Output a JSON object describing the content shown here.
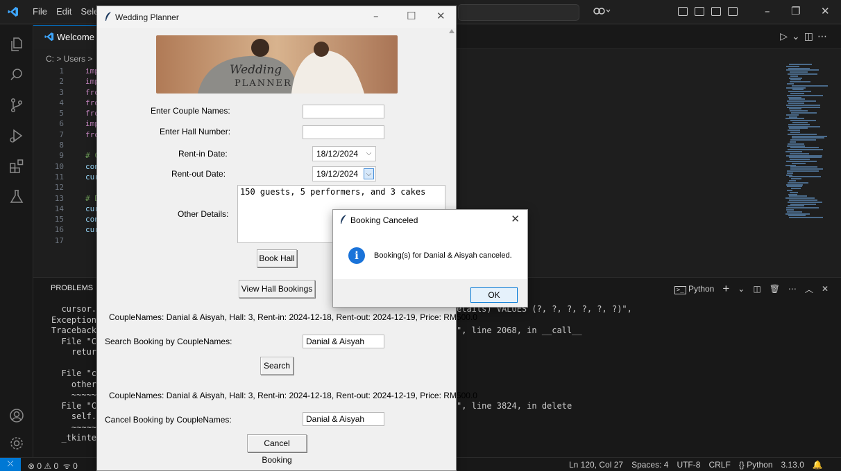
{
  "vscode": {
    "menu": [
      "File",
      "Edit",
      "Sele"
    ],
    "tab_label": "Welcome",
    "breadcrumb": "C: > Users >",
    "code_lines": [
      {
        "n": "1",
        "text": "imp",
        "cls": "kw"
      },
      {
        "n": "2",
        "text": "imp",
        "cls": "kw"
      },
      {
        "n": "3",
        "text": "fro",
        "cls": "kw"
      },
      {
        "n": "4",
        "text": "fro",
        "cls": "kw"
      },
      {
        "n": "5",
        "text": "fro",
        "cls": "kw"
      },
      {
        "n": "6",
        "text": "imp",
        "cls": "kw"
      },
      {
        "n": "7",
        "text": "fro",
        "cls": "kw"
      },
      {
        "n": "8",
        "text": "",
        "cls": ""
      },
      {
        "n": "9",
        "text": "# C",
        "cls": "cm"
      },
      {
        "n": "10",
        "text": "con",
        "cls": "var"
      },
      {
        "n": "11",
        "text": "cur",
        "cls": "var"
      },
      {
        "n": "12",
        "text": "",
        "cls": ""
      },
      {
        "n": "13",
        "text": "# D",
        "cls": "cm"
      },
      {
        "n": "14",
        "text": "cur",
        "cls": "var"
      },
      {
        "n": "15",
        "text": "con",
        "cls": "var"
      },
      {
        "n": "16",
        "text": "cur",
        "cls": "var"
      },
      {
        "n": "17",
        "text": "",
        "cls": ""
      }
    ],
    "panel_tab": "PROBLEMS",
    "terminal_profile": "Python",
    "terminal_left": [
      "  cursor.",
      "Exception",
      "Traceback",
      "  File \"C:",
      "    return",
      "",
      "  File \"c",
      "    other",
      "    ~~~~~~",
      "  File \"C:",
      "    self.t",
      "    ~~~~~~",
      "  _tkinter.T"
    ],
    "terminal_right": [
      {
        "text": "etails) VALUES (?, ?, ?, ?, ?, ?)\",",
        "row": 0
      },
      {
        "text": "\", line 2068, in __call__",
        "row": 2
      },
      {
        "text": "\", line 3824, in delete",
        "row": 9
      }
    ],
    "status": {
      "remote": "⤫",
      "problems": "⊗ 0 ⚠ 0",
      "ports": "ᯤ 0",
      "right": [
        "Ln 120, Col 27",
        "Spaces: 4",
        "UTF-8",
        "CRLF",
        "{} Python",
        "3.13.0",
        "🔔"
      ]
    }
  },
  "tk": {
    "title": "Wedding Planner",
    "banner_text_1": "Wedding",
    "banner_text_2": "PLANNER",
    "labels": {
      "couple": "Enter Couple Names:",
      "hall": "Enter Hall Number:",
      "rent_in": "Rent-in Date:",
      "rent_out": "Rent-out Date:",
      "details": "Other Details:"
    },
    "couple_value": "",
    "hall_value": "",
    "rent_in_value": "18/12/2024",
    "rent_out_value": "19/12/2024",
    "details_value": "150 guests, 5 performers, and 3 cakes",
    "book_button": "Book Hall",
    "view_button": "View Hall Bookings",
    "booking_result_1": "CoupleNames: Danial & Aisyah, Hall: 3, Rent-in: 2024-12-18, Rent-out: 2024-12-19, Price: RM500.0",
    "search_label": "Search Booking by CoupleNames:",
    "search_value": "Danial & Aisyah",
    "search_button": "Search",
    "booking_result_2": "CoupleNames: Danial & Aisyah, Hall: 3, Rent-in: 2024-12-18, Rent-out: 2024-12-19, Price: RM500.0",
    "cancel_label": "Cancel Booking by CoupleNames:",
    "cancel_value": "Danial & Aisyah",
    "cancel_button": "Cancel Booking"
  },
  "dialog": {
    "title": "Booking Canceled",
    "message": "Booking(s) for Danial & Aisyah canceled.",
    "ok": "OK"
  },
  "colors": {
    "vscode_bg": "#1e1e1e",
    "accent": "#0078d4",
    "info_icon": "#1a73d9"
  }
}
